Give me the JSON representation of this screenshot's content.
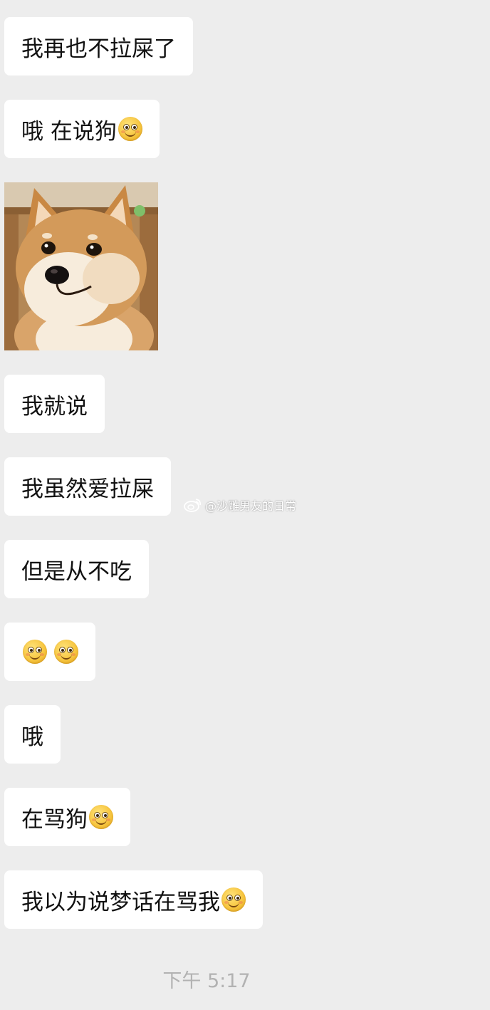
{
  "messages": [
    {
      "text": "我再也不拉屎了",
      "emoji_count": 0
    },
    {
      "text": "哦 在说狗",
      "emoji_count": 1
    },
    {
      "text": "我就说",
      "emoji_count": 0
    },
    {
      "text": "我虽然爱拉屎",
      "emoji_count": 0
    },
    {
      "text": "但是从不吃",
      "emoji_count": 0
    },
    {
      "text": "",
      "emoji_count": 2
    },
    {
      "text": "哦",
      "emoji_count": 0
    },
    {
      "text": "在骂狗",
      "emoji_count": 1
    },
    {
      "text": "我以为说梦话在骂我",
      "emoji_count": 1
    }
  ],
  "sticker": {
    "icon": "shiba-inu-dog-sticker"
  },
  "emoji": {
    "icon": "smiling-face-emoji"
  },
  "watermark": {
    "text": "@沙雕男友的日常",
    "icon": "weibo-logo-icon"
  },
  "timestamp": "下午 5:17",
  "colors": {
    "background": "#ededed",
    "bubble": "#ffffff",
    "timestamp": "#b2b2b2"
  }
}
